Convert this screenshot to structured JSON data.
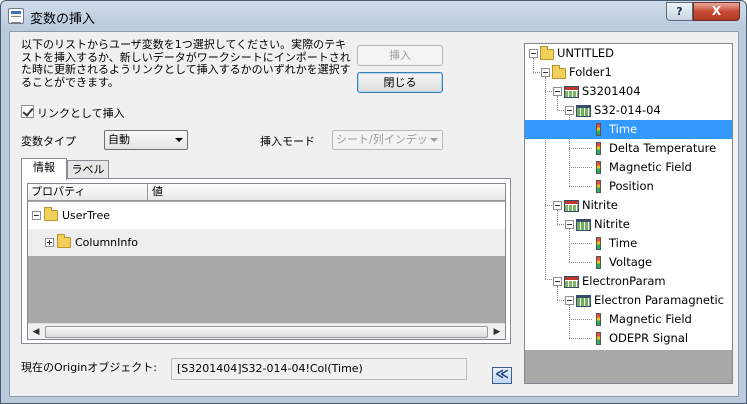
{
  "window": {
    "title": "変数の挿入",
    "help_label": "?",
    "close_label": "X"
  },
  "description": "以下のリストからユーザ変数を1つ選択してください。実際のテキストを挿入するか、新しいデータがワークシートにインポートされた時に更新されるようリンクとして挿入するかのいずれかを選択することができます。",
  "buttons": {
    "insert": "挿入",
    "close": "閉じる",
    "collapse": "≪"
  },
  "link_checkbox": {
    "label": "リンクとして挿入",
    "checked": true
  },
  "variable_type": {
    "label": "変数タイプ",
    "value": "自動"
  },
  "insert_mode": {
    "label": "挿入モード",
    "value": "シート/列インデッ"
  },
  "tabs": [
    {
      "label": "情報",
      "active": true
    },
    {
      "label": "ラベル",
      "active": false
    }
  ],
  "grid": {
    "columns": [
      "プロパティ",
      "値"
    ],
    "rows": [
      {
        "label": "UserTree",
        "expander": "minus"
      },
      {
        "label": "ColumnInfo",
        "expander": "plus"
      }
    ]
  },
  "current_object": {
    "label": "現在のOriginオブジェクト:",
    "value": "[S3201404]S32-014-04!Col(Time)"
  },
  "tree": {
    "nodes": [
      {
        "label": "UNTITLED",
        "icon": "folder-icon"
      },
      {
        "label": "Folder1",
        "icon": "folder-icon"
      },
      {
        "label": "S3201404",
        "icon": "workbook-icon"
      },
      {
        "label": "S32-014-04",
        "icon": "worksheet-icon"
      },
      {
        "label": "Time",
        "icon": "column-icon",
        "selected": true
      },
      {
        "label": "Delta Temperature",
        "icon": "column-icon"
      },
      {
        "label": "Magnetic Field",
        "icon": "column-icon"
      },
      {
        "label": "Position",
        "icon": "column-icon"
      },
      {
        "label": "Nitrite",
        "icon": "workbook-icon"
      },
      {
        "label": "Nitrite",
        "icon": "worksheet-icon"
      },
      {
        "label": "Time",
        "icon": "column-icon"
      },
      {
        "label": "Voltage",
        "icon": "column-icon"
      },
      {
        "label": "ElectronParam",
        "icon": "workbook-icon"
      },
      {
        "label": "Electron Paramagnetic",
        "icon": "worksheet-icon"
      },
      {
        "label": "Magnetic Field",
        "icon": "column-icon"
      },
      {
        "label": "ODEPR Signal",
        "icon": "column-icon"
      }
    ]
  },
  "colors": {
    "selection": "#3399ff",
    "window_frame": "#b9cadd",
    "client": "#f0f0f0"
  }
}
